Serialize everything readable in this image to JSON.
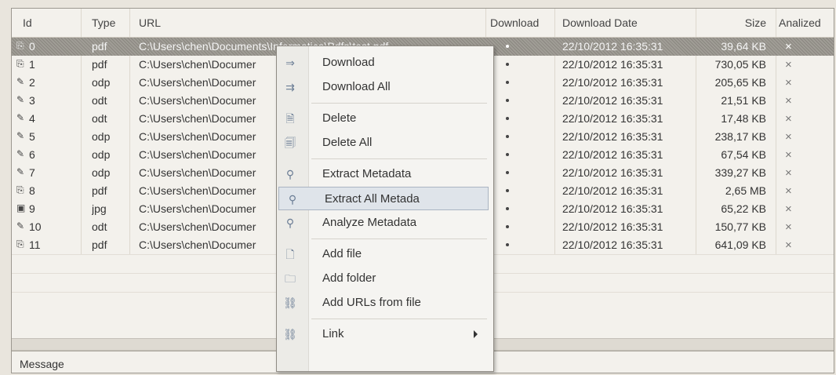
{
  "columns": [
    "Id",
    "Type",
    "URL",
    "Download",
    "Download Date",
    "Size",
    "Analized"
  ],
  "rows": [
    {
      "id": "0",
      "type": "pdf",
      "url": "C:\\Users\\chen\\Documents\\Informatica\\Pdfs\\test.pdf",
      "date": "22/10/2012 16:35:31",
      "size": "39,64 KB",
      "an": "×"
    },
    {
      "id": "1",
      "type": "pdf",
      "url": "C:\\Users\\chen\\Documer",
      "date": "22/10/2012 16:35:31",
      "size": "730,05 KB",
      "an": "×"
    },
    {
      "id": "2",
      "type": "odp",
      "url": "C:\\Users\\chen\\Documer",
      "date": "22/10/2012 16:35:31",
      "size": "205,65 KB",
      "an": "×"
    },
    {
      "id": "3",
      "type": "odt",
      "url": "C:\\Users\\chen\\Documer",
      "date": "22/10/2012 16:35:31",
      "size": "21,51 KB",
      "an": "×"
    },
    {
      "id": "4",
      "type": "odt",
      "url": "C:\\Users\\chen\\Documer",
      "date": "22/10/2012 16:35:31",
      "size": "17,48 KB",
      "an": "×"
    },
    {
      "id": "5",
      "type": "odp",
      "url": "C:\\Users\\chen\\Documer",
      "date": "22/10/2012 16:35:31",
      "size": "238,17 KB",
      "an": "×"
    },
    {
      "id": "6",
      "type": "odp",
      "url": "C:\\Users\\chen\\Documer",
      "date": "22/10/2012 16:35:31",
      "size": "67,54 KB",
      "an": "×"
    },
    {
      "id": "7",
      "type": "odp",
      "url": "C:\\Users\\chen\\Documer",
      "date": "22/10/2012 16:35:31",
      "size": "339,27 KB",
      "an": "×"
    },
    {
      "id": "8",
      "type": "pdf",
      "url": "C:\\Users\\chen\\Documer",
      "date": "22/10/2012 16:35:31",
      "size": "2,65 MB",
      "an": "×"
    },
    {
      "id": "9",
      "type": "jpg",
      "url": "C:\\Users\\chen\\Documer",
      "date": "22/10/2012 16:35:31",
      "size": "65,22 KB",
      "an": "×"
    },
    {
      "id": "10",
      "type": "odt",
      "url": "C:\\Users\\chen\\Documer",
      "date": "22/10/2012 16:35:31",
      "size": "150,77 KB",
      "an": "×"
    },
    {
      "id": "11",
      "type": "pdf",
      "url": "C:\\Users\\chen\\Documer",
      "date": "22/10/2012 16:35:31",
      "size": "641,09 KB",
      "an": "×"
    }
  ],
  "menu": [
    {
      "label": "Download",
      "icon": "download-icon",
      "glyph": "⇒"
    },
    {
      "label": "Download All",
      "icon": "download-all-icon",
      "glyph": "⇉"
    },
    {
      "sep": true
    },
    {
      "label": "Delete",
      "icon": "delete-icon",
      "glyph": "🗎"
    },
    {
      "label": "Delete All",
      "icon": "delete-all-icon",
      "glyph": "🗐"
    },
    {
      "sep": true
    },
    {
      "label": "Extract Metadata",
      "icon": "binoculars-icon",
      "glyph": "⚲"
    },
    {
      "label": "Extract All Metada",
      "icon": "binoculars-all-icon",
      "glyph": "⚲",
      "highlight": true
    },
    {
      "label": "Analyze Metadata",
      "icon": "magnifier-icon",
      "glyph": "⚲"
    },
    {
      "sep": true
    },
    {
      "label": "Add file",
      "icon": "add-file-icon",
      "glyph": "🗋"
    },
    {
      "label": "Add folder",
      "icon": "add-folder-icon",
      "glyph": "🗀"
    },
    {
      "label": "Add URLs from file",
      "icon": "add-urls-icon",
      "glyph": "⛓"
    },
    {
      "sep": true
    },
    {
      "label": "Link",
      "icon": "link-icon",
      "glyph": "⛓",
      "submenu": true
    }
  ],
  "message_label": "Message",
  "colors": {
    "selected": "#959189",
    "menu_highlight": "#dfe4ea"
  }
}
